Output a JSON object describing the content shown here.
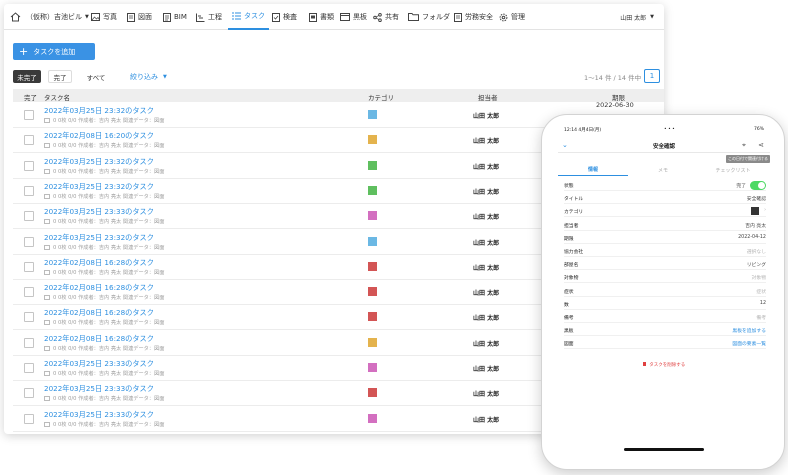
{
  "nav": {
    "project": "（仮称）吉池ビル",
    "items": [
      "写真",
      "図面",
      "BIM",
      "工程",
      "タスク",
      "検査",
      "書類",
      "黒板",
      "共有",
      "フォルダ",
      "労務安全",
      "管理"
    ],
    "user": "山田 太郎"
  },
  "toolbar": {
    "add_label": "タスクを追加"
  },
  "filters": {
    "incomplete": "未完了",
    "complete": "完了",
    "all": "すべて",
    "narrow": "絞り込み"
  },
  "pagination": {
    "info": "1〜14 件 / 14 件中",
    "page": "1"
  },
  "table": {
    "headers": {
      "done": "完了",
      "name": "タスク名",
      "category": "カテゴリ",
      "assignee": "担当者",
      "due": "期限"
    },
    "rows": [
      {
        "title": "2022年03月25日 23:32のタスク",
        "meta": "0  0枚  0/0    作成者：吉内 亮太    関連データ：図面",
        "color": "#6bb8e4",
        "assignee": "山田 太郎",
        "due": "2022-06-30"
      },
      {
        "title": "2022年02月08日 16:20のタスク",
        "meta": "0  0枚  0/0    作成者：吉内 亮太    関連データ：図面",
        "color": "#e4b34d",
        "assignee": "山田 太郎",
        "due": ""
      },
      {
        "title": "2022年03月25日 23:32のタスク",
        "meta": "0  0枚  0/0    作成者：吉内 亮太    関連データ：図面",
        "color": "#5fbf5f",
        "assignee": "山田 太郎",
        "due": ""
      },
      {
        "title": "2022年03月25日 23:32のタスク",
        "meta": "0  0枚  0/0    作成者：吉内 亮太    関連データ：図面",
        "color": "#5fbf5f",
        "assignee": "山田 太郎",
        "due": ""
      },
      {
        "title": "2022年03月25日 23:33のタスク",
        "meta": "0  0枚  0/0    作成者：吉内 亮太    関連データ：図面",
        "color": "#d36fc0",
        "assignee": "山田 太郎",
        "due": ""
      },
      {
        "title": "2022年03月25日 23:32のタスク",
        "meta": "0  0枚  0/0    作成者：吉内 亮太    関連データ：図面",
        "color": "#6bb8e4",
        "assignee": "山田 太郎",
        "due": ""
      },
      {
        "title": "2022年02月08日 16:28のタスク",
        "meta": "0  0枚  0/0    作成者：吉内 亮太    関連データ：図面",
        "color": "#d35555",
        "assignee": "山田 太郎",
        "due": ""
      },
      {
        "title": "2022年02月08日 16:28のタスク",
        "meta": "0  0枚  0/0    作成者：吉内 亮太    関連データ：図面",
        "color": "#d35555",
        "assignee": "山田 太郎",
        "due": ""
      },
      {
        "title": "2022年02月08日 16:28のタスク",
        "meta": "0  0枚  0/0    作成者：吉内 亮太    関連データ：図面",
        "color": "#d35555",
        "assignee": "山田 太郎",
        "due": ""
      },
      {
        "title": "2022年02月08日 16:28のタスク",
        "meta": "0  0枚  0/0    作成者：吉内 亮太    関連データ：図面",
        "color": "#e4b34d",
        "assignee": "山田 太郎",
        "due": ""
      },
      {
        "title": "2022年03月25日 23:33のタスク",
        "meta": "0  0枚  0/0    作成者：吉内 亮太    関連データ：図面",
        "color": "#d36fc0",
        "assignee": "山田 太郎",
        "due": ""
      },
      {
        "title": "2022年03月25日 23:33のタスク",
        "meta": "0  0枚  0/0    作成者：吉内 亮太    関連データ：図面",
        "color": "#d35555",
        "assignee": "山田 太郎",
        "due": ""
      },
      {
        "title": "2022年03月25日 23:33のタスク",
        "meta": "0  0枚  0/0    作成者：吉内 亮太    関連データ：図面",
        "color": "#d36fc0",
        "assignee": "山田 太郎",
        "due": ""
      }
    ]
  },
  "phone": {
    "status_time": "12:14  4月4日(月)",
    "status_right": "76%",
    "title": "安全確認",
    "banner": "この日付で関連付ける",
    "tabs": [
      "情報",
      "メモ",
      "チェックリスト"
    ],
    "fields": [
      {
        "k": "状態",
        "v": "完了",
        "type": "toggle"
      },
      {
        "k": "タイトル",
        "v": "安全確認",
        "type": "text"
      },
      {
        "k": "カテゴリ",
        "v": "",
        "type": "swatch"
      },
      {
        "k": "担当者",
        "v": "吉内 亮太",
        "type": "text"
      },
      {
        "k": "期限",
        "v": "2022-04-12",
        "type": "text"
      },
      {
        "k": "協力会社",
        "v": "選択なし",
        "type": "muted"
      },
      {
        "k": "部屋名",
        "v": "リビング",
        "type": "text"
      },
      {
        "k": "対象物",
        "v": "対象物",
        "type": "muted"
      },
      {
        "k": "症状",
        "v": "症状",
        "type": "muted"
      },
      {
        "k": "数",
        "v": "12",
        "type": "text"
      },
      {
        "k": "備考",
        "v": "備考",
        "type": "muted"
      },
      {
        "k": "黒板",
        "v": "黒板を追加する",
        "type": "link"
      },
      {
        "k": "図面",
        "v": "図面の要素一覧",
        "type": "link"
      }
    ],
    "delete_label": "タスクを削除する"
  }
}
